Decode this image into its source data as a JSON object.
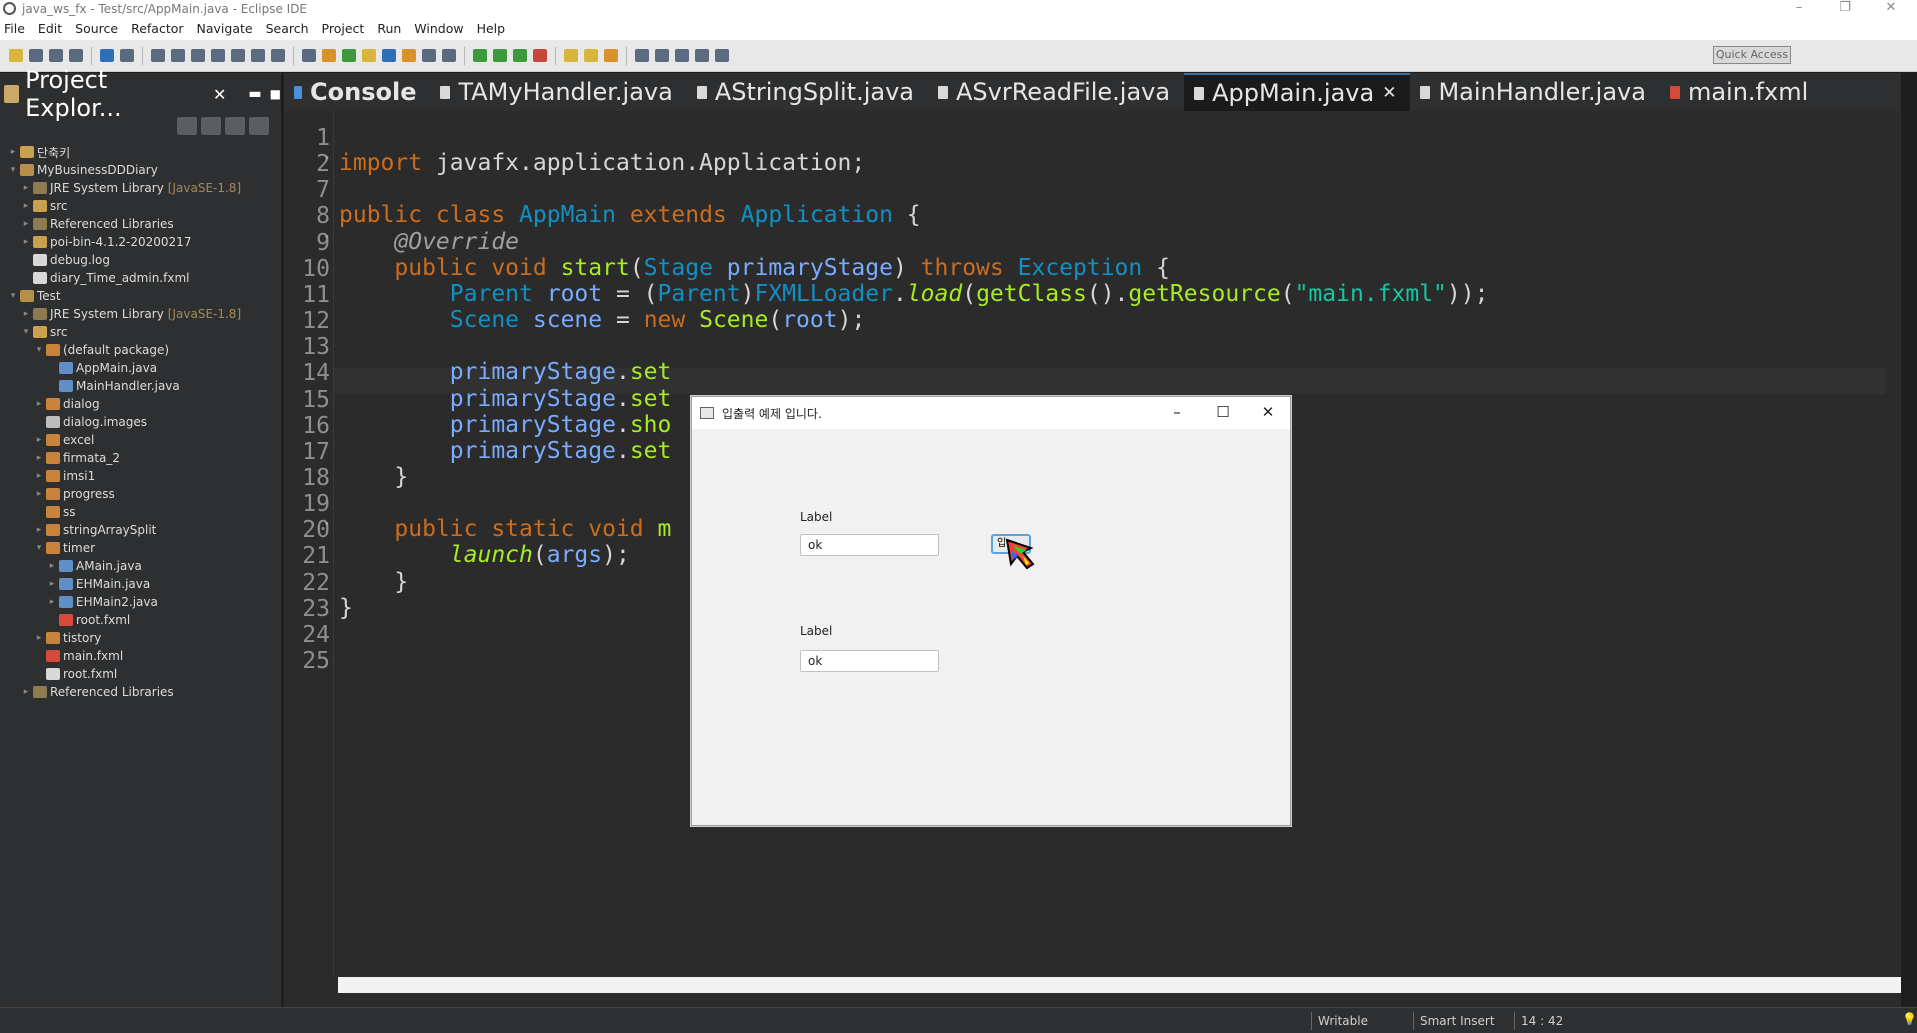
{
  "window": {
    "title": "java_ws_fx - Test/src/AppMain.java - Eclipse IDE"
  },
  "menu": [
    "File",
    "Edit",
    "Source",
    "Refactor",
    "Navigate",
    "Search",
    "Project",
    "Run",
    "Window",
    "Help"
  ],
  "toolbar": {
    "quick_access": "Quick Access"
  },
  "explorer": {
    "title": "Project Explor...",
    "items": [
      {
        "label": "단축키",
        "depth": 0,
        "icon": "folder-icon",
        "arrow": "▸"
      },
      {
        "label": "MyBusinessDDDiary",
        "depth": 0,
        "icon": "project-icon",
        "arrow": "▾"
      },
      {
        "label": "JRE System Library",
        "dec": "[JavaSE-1.8]",
        "depth": 1,
        "icon": "library-icon",
        "arrow": "▸"
      },
      {
        "label": "src",
        "depth": 1,
        "icon": "source-folder-icon",
        "arrow": "▸"
      },
      {
        "label": "Referenced Libraries",
        "depth": 1,
        "icon": "library-icon",
        "arrow": "▸"
      },
      {
        "label": "poi-bin-4.1.2-20200217",
        "depth": 1,
        "icon": "folder-icon",
        "arrow": "▸"
      },
      {
        "label": "debug.log",
        "depth": 1,
        "icon": "file-icon",
        "arrow": ""
      },
      {
        "label": "diary_Time_admin.fxml",
        "depth": 1,
        "icon": "file-icon",
        "arrow": ""
      },
      {
        "label": "Test",
        "depth": 0,
        "icon": "project-icon",
        "arrow": "▾"
      },
      {
        "label": "JRE System Library",
        "dec": "[JavaSE-1.8]",
        "depth": 1,
        "icon": "library-icon",
        "arrow": "▸"
      },
      {
        "label": "src",
        "depth": 1,
        "icon": "source-folder-icon",
        "arrow": "▾"
      },
      {
        "label": "(default package)",
        "depth": 2,
        "icon": "package-icon",
        "arrow": "▾"
      },
      {
        "label": "AppMain.java",
        "depth": 3,
        "icon": "java-file-icon",
        "arrow": ""
      },
      {
        "label": "MainHandler.java",
        "depth": 3,
        "icon": "java-file-icon",
        "arrow": ""
      },
      {
        "label": "dialog",
        "depth": 2,
        "icon": "package-icon",
        "arrow": "▸"
      },
      {
        "label": "dialog.images",
        "depth": 2,
        "icon": "image-package-icon",
        "arrow": ""
      },
      {
        "label": "excel",
        "depth": 2,
        "icon": "package-icon",
        "arrow": "▸"
      },
      {
        "label": "firmata_2",
        "depth": 2,
        "icon": "package-icon",
        "arrow": "▸"
      },
      {
        "label": "imsi1",
        "depth": 2,
        "icon": "package-icon",
        "arrow": "▸"
      },
      {
        "label": "progress",
        "depth": 2,
        "icon": "package-icon",
        "arrow": "▸"
      },
      {
        "label": "ss",
        "depth": 2,
        "icon": "package-icon",
        "arrow": ""
      },
      {
        "label": "stringArraySplit",
        "depth": 2,
        "icon": "package-icon",
        "arrow": "▸"
      },
      {
        "label": "timer",
        "depth": 2,
        "icon": "package-icon",
        "arrow": "▾"
      },
      {
        "label": "AMain.java",
        "depth": 3,
        "icon": "java-file-icon",
        "arrow": "▸"
      },
      {
        "label": "EHMain.java",
        "depth": 3,
        "icon": "java-file-icon",
        "arrow": "▸"
      },
      {
        "label": "EHMain2.java",
        "depth": 3,
        "icon": "java-file-icon",
        "arrow": "▸"
      },
      {
        "label": "root.fxml",
        "depth": 3,
        "icon": "fxml-file-icon",
        "arrow": ""
      },
      {
        "label": "tistory",
        "depth": 2,
        "icon": "package-icon",
        "arrow": "▸"
      },
      {
        "label": "main.fxml",
        "depth": 2,
        "icon": "fxml-file-icon",
        "arrow": ""
      },
      {
        "label": "root.fxml",
        "depth": 2,
        "icon": "file-icon",
        "arrow": ""
      },
      {
        "label": "Referenced Libraries",
        "depth": 1,
        "icon": "library-icon",
        "arrow": "▸"
      }
    ]
  },
  "tabs": [
    {
      "label": "Console",
      "kind": "console"
    },
    {
      "label": "TAMyHandler.java",
      "kind": "java"
    },
    {
      "label": "AStringSplit.java",
      "kind": "java"
    },
    {
      "label": "ASvrReadFile.java",
      "kind": "java"
    },
    {
      "label": "AppMain.java",
      "kind": "java",
      "active": true
    },
    {
      "label": "MainHandler.java",
      "kind": "java"
    },
    {
      "label": "main.fxml",
      "kind": "fxml"
    }
  ],
  "code": [
    {
      "n": "1",
      "m": "",
      "html": ""
    },
    {
      "n": "2",
      "m": "•",
      "html": "<span class='kw'>import</span> javafx.application.Application;"
    },
    {
      "n": "7",
      "m": "",
      "html": ""
    },
    {
      "n": "8",
      "m": "",
      "html": "<span class='kw'>public class</span> <span class='ty'>AppMain</span> <span class='kw'>extends</span> <span class='ty'>Application</span> {"
    },
    {
      "n": "9",
      "m": "•",
      "html": "    <span class='ann'>@Override</span>"
    },
    {
      "n": "10",
      "m": "",
      "html": "    <span class='kw'>public void</span> <span class='mth'>start</span>(<span class='ty'>Stage</span> <span class='id'>primaryStage</span>) <span class='kw'>throws</span> <span class='ty'>Exception</span> {"
    },
    {
      "n": "11",
      "m": "",
      "html": "        <span class='ty'>Parent</span> <span class='id'>root</span> = (<span class='ty'>Parent</span>)<span class='ty'>FXMLLoader</span>.<span class='mth it'>load</span>(<span class='mth'>getClass</span>().<span class='mth'>getResource</span>(<span class='str'>\"main.fxml\"</span>));"
    },
    {
      "n": "12",
      "m": "",
      "html": "        <span class='ty'>Scene</span> <span class='id'>scene</span> = <span class='kw'>new</span> <span class='mth'>Scene</span>(<span class='id'>root</span>);"
    },
    {
      "n": "13",
      "m": "",
      "html": ""
    },
    {
      "n": "14",
      "m": "",
      "html": "        <span class='id'>primaryStage</span>.<span class='mth'>set</span>"
    },
    {
      "n": "15",
      "m": "",
      "html": "        <span class='id'>primaryStage</span>.<span class='mth'>set</span>"
    },
    {
      "n": "16",
      "m": "",
      "html": "        <span class='id'>primaryStage</span>.<span class='mth'>sho</span>"
    },
    {
      "n": "17",
      "m": "",
      "html": "        <span class='id'>primaryStage</span>.<span class='mth'>set</span>"
    },
    {
      "n": "18",
      "m": "",
      "html": "    }"
    },
    {
      "n": "19",
      "m": "",
      "html": ""
    },
    {
      "n": "20",
      "m": "•",
      "html": "    <span class='kw'>public static void</span> <span class='mth'>m</span>"
    },
    {
      "n": "21",
      "m": "",
      "html": "        <span class='mth it'>launch</span>(<span class='id'>args</span>);"
    },
    {
      "n": "22",
      "m": "",
      "html": "    }"
    },
    {
      "n": "23",
      "m": "",
      "html": "}"
    },
    {
      "n": "24",
      "m": "",
      "html": ""
    },
    {
      "n": "25",
      "m": "",
      "html": ""
    }
  ],
  "status": {
    "writable": "Writable",
    "insert": "Smart Insert",
    "position": "14 : 42"
  },
  "dialog": {
    "title": "입출력 예제 입니다.",
    "label1": "Label",
    "field1": "ok",
    "label2": "Label",
    "field2": "ok",
    "button": "입"
  }
}
